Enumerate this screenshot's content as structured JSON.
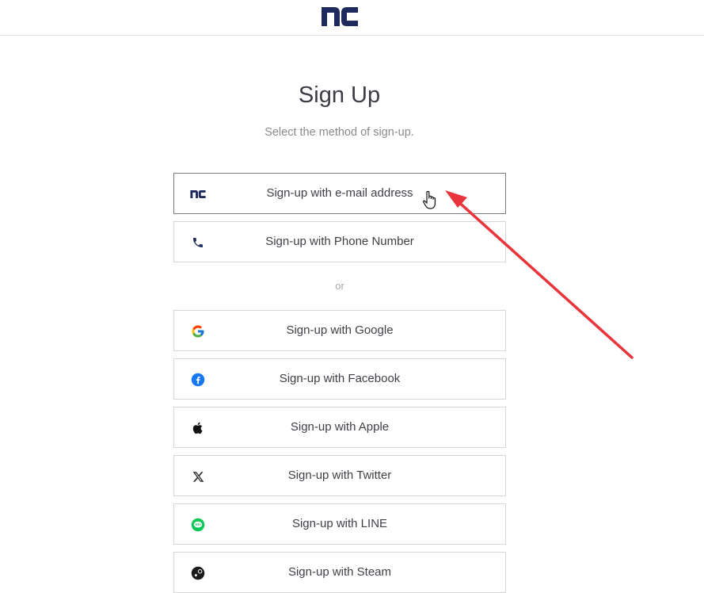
{
  "header": {
    "logo_text": "nc"
  },
  "page": {
    "title": "Sign Up",
    "subtitle": "Select the method of sign-up."
  },
  "primary_methods": [
    {
      "label": "Sign-up with e-mail address",
      "icon": "nc-logo-icon"
    },
    {
      "label": "Sign-up with Phone Number",
      "icon": "phone-icon"
    }
  ],
  "divider": {
    "text": "or"
  },
  "social_methods": [
    {
      "label": "Sign-up with Google",
      "icon": "google-icon"
    },
    {
      "label": "Sign-up with Facebook",
      "icon": "facebook-icon"
    },
    {
      "label": "Sign-up with Apple",
      "icon": "apple-icon"
    },
    {
      "label": "Sign-up with Twitter",
      "icon": "x-icon"
    },
    {
      "label": "Sign-up with LINE",
      "icon": "line-icon"
    },
    {
      "label": "Sign-up with Steam",
      "icon": "steam-icon"
    }
  ],
  "colors": {
    "brand": "#1f2a5c",
    "arrow": "#e8343a",
    "facebook": "#1877f2",
    "line": "#06c755"
  }
}
